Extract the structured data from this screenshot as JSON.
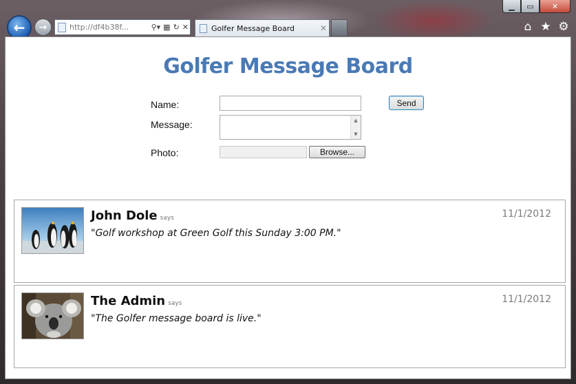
{
  "browser": {
    "address_url": "http://df4b38f...",
    "tab_title": "Golfer Message Board",
    "window_buttons": [
      "minimize-icon",
      "maximize-icon",
      "close-icon"
    ],
    "tool_icons": [
      "home-icon",
      "star-icon",
      "gear-icon"
    ]
  },
  "page": {
    "title": "Golfer Message Board",
    "form": {
      "name_label": "Name:",
      "message_label": "Message:",
      "photo_label": "Photo:",
      "name_value": "",
      "message_value": "",
      "browse_label": "Browse...",
      "send_label": "Send"
    },
    "posts": [
      {
        "author": "John Dole",
        "says": "says",
        "date": "11/1/2012",
        "text": "\"Golf workshop at Green Golf this Sunday 3:00 PM.\"",
        "photo": "penguins-photo"
      },
      {
        "author": "The Admin",
        "says": "says",
        "date": "11/1/2012",
        "text": "\"The Golfer message board is live.\"",
        "photo": "koala-photo"
      }
    ]
  }
}
